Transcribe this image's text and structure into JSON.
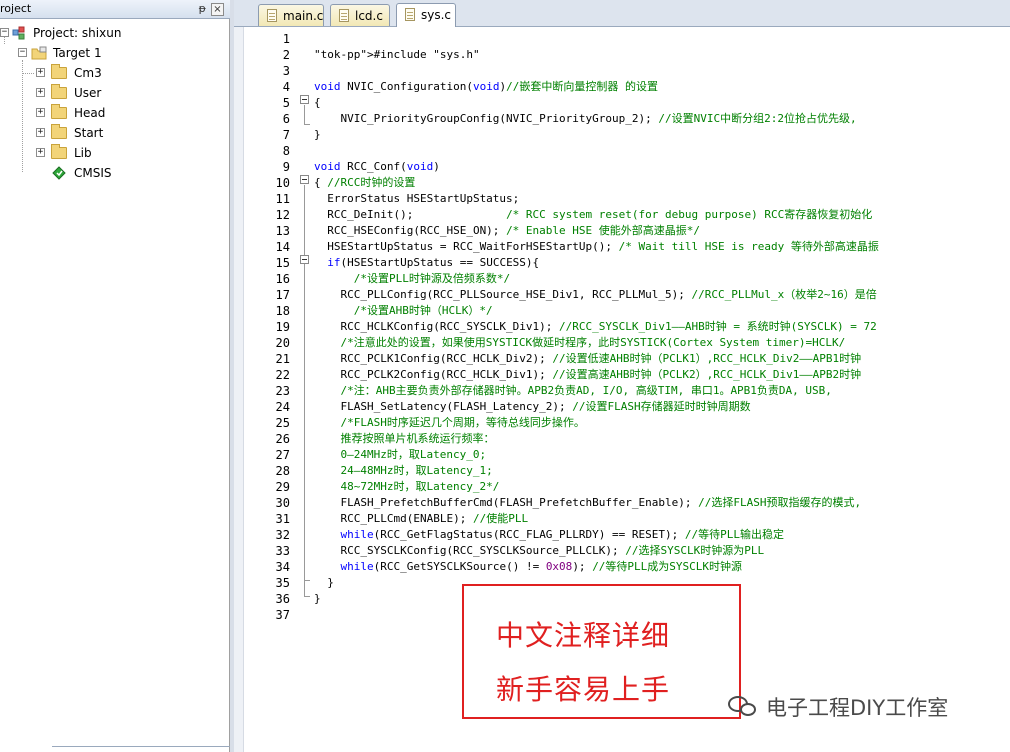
{
  "project_pane": {
    "title": "roject",
    "pin_glyph": "ᵽ",
    "close_glyph": "×",
    "root": "Project: shixun",
    "target": "Target 1",
    "groups": [
      {
        "label": "Cm3",
        "icon": "folder-icon"
      },
      {
        "label": "User",
        "icon": "folder-icon"
      },
      {
        "label": "Head",
        "icon": "folder-icon"
      },
      {
        "label": "Start",
        "icon": "folder-icon"
      },
      {
        "label": "Lib",
        "icon": "folder-icon"
      },
      {
        "label": "CMSIS",
        "icon": "green-diamond-icon"
      }
    ]
  },
  "tabs": [
    {
      "label": "main.c",
      "active": false
    },
    {
      "label": "lcd.c",
      "active": false
    },
    {
      "label": "sys.c",
      "active": true
    }
  ],
  "editor": {
    "line_numbers": [
      "1",
      "2",
      "3",
      "4",
      "5",
      "6",
      "7",
      "8",
      "9",
      "10",
      "11",
      "12",
      "13",
      "14",
      "15",
      "16",
      "17",
      "18",
      "19",
      "20",
      "21",
      "22",
      "23",
      "24",
      "25",
      "26",
      "27",
      "28",
      "29",
      "30",
      "31",
      "32",
      "33",
      "34",
      "35",
      "36",
      "37"
    ],
    "lines": [
      "",
      "#include \"sys.h\"",
      "",
      "void NVIC_Configuration(void)//嵌套中断向量控制器 的设置",
      "{",
      "    NVIC_PriorityGroupConfig(NVIC_PriorityGroup_2); //设置NVIC中断分组2:2位抢占优先级,",
      "}",
      "",
      "void RCC_Conf(void)",
      "{ //RCC时钟的设置",
      "  ErrorStatus HSEStartUpStatus;",
      "  RCC_DeInit();              /* RCC system reset(for debug purpose) RCC寄存器恢复初始化",
      "  RCC_HSEConfig(RCC_HSE_ON); /* Enable HSE 使能外部高速晶振*/",
      "  HSEStartUpStatus = RCC_WaitForHSEStartUp(); /* Wait till HSE is ready 等待外部高速晶振",
      "  if(HSEStartUpStatus == SUCCESS){",
      "      /*设置PLL时钟源及倍频系数*/",
      "    RCC_PLLConfig(RCC_PLLSource_HSE_Div1, RCC_PLLMul_5); //RCC_PLLMul_x（枚举2~16）是倍",
      "      /*设置AHB时钟（HCLK）*/",
      "    RCC_HCLKConfig(RCC_SYSCLK_Div1); //RCC_SYSCLK_Div1——AHB时钟 = 系统时钟(SYSCLK) = 72",
      "    /*注意此处的设置，如果使用SYSTICK做延时程序，此时SYSTICK(Cortex System timer)=HCLK/",
      "    RCC_PCLK1Config(RCC_HCLK_Div2); //设置低速AHB时钟（PCLK1）,RCC_HCLK_Div2——APB1时钟",
      "    RCC_PCLK2Config(RCC_HCLK_Div1); //设置高速AHB时钟（PCLK2）,RCC_HCLK_Div1——APB2时钟",
      "    /*注：AHB主要负责外部存储器时钟。APB2负责AD, I/O, 高级TIM, 串口1。APB1负责DA, USB,",
      "    FLASH_SetLatency(FLASH_Latency_2); //设置FLASH存储器延时时钟周期数",
      "    /*FLASH时序延迟几个周期，等待总线同步操作。",
      "    推荐按照单片机系统运行频率：",
      "    0—24MHz时，取Latency_0;",
      "    24—48MHz时，取Latency_1;",
      "    48~72MHz时，取Latency_2*/",
      "    FLASH_PrefetchBufferCmd(FLASH_PrefetchBuffer_Enable); //选择FLASH预取指缓存的模式,",
      "    RCC_PLLCmd(ENABLE); //使能PLL",
      "    while(RCC_GetFlagStatus(RCC_FLAG_PLLRDY) == RESET); //等待PLL输出稳定",
      "    RCC_SYSCLKConfig(RCC_SYSCLKSource_PLLCLK); //选择SYSCLK时钟源为PLL",
      "    while(RCC_GetSYSCLKSource() != 0x08); //等待PLL成为SYSCLK时钟源",
      "  }",
      "}",
      ""
    ]
  },
  "overlay": {
    "line1": "中文注释详细",
    "line2": "新手容易上手",
    "watermark": "电子工程DIY工作室"
  },
  "colors": {
    "keyword": "#0000ff",
    "comment": "#008000",
    "string": "#800080",
    "overlay_red": "#e02020"
  }
}
